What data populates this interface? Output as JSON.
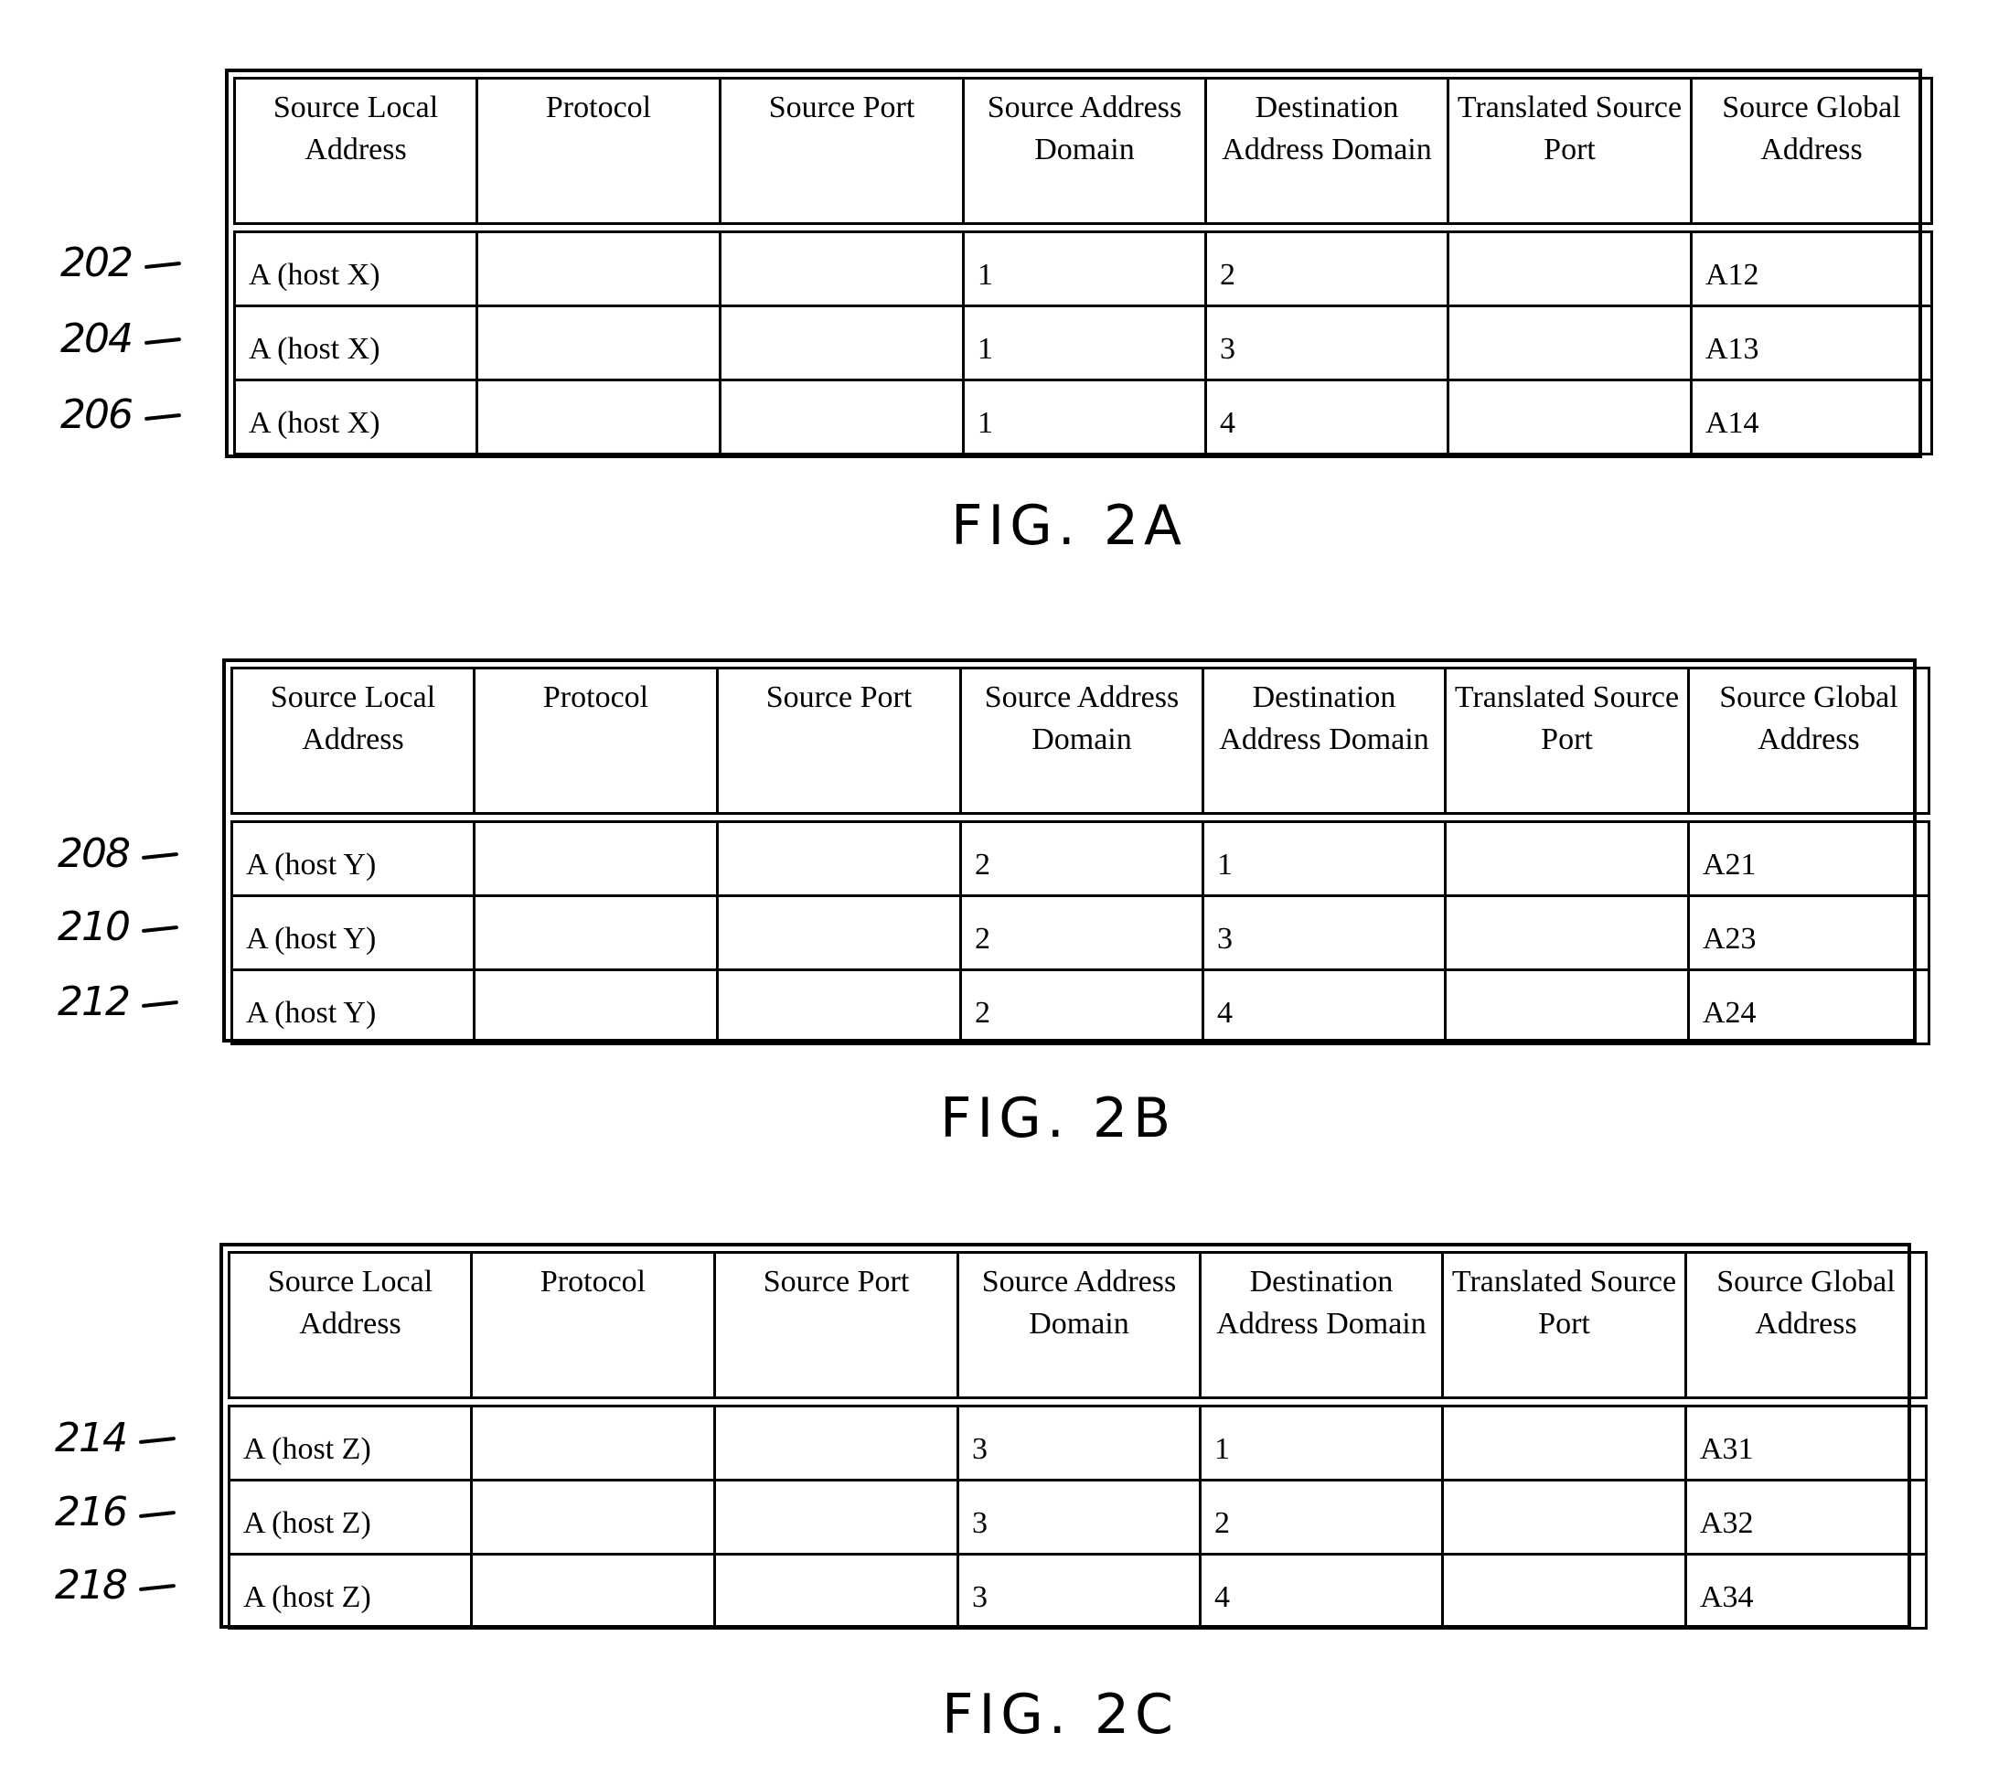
{
  "columns": [
    "Source Local Address",
    "Protocol",
    "Source Port",
    "Source Address Domain",
    "Destination Address Domain",
    "Translated Source Port",
    "Source Global Address"
  ],
  "figures": [
    {
      "label": "FIG. 2A",
      "rows": [
        {
          "ref": "202",
          "cells": [
            "A (host X)",
            "",
            "",
            "1",
            "2",
            "",
            "A12"
          ]
        },
        {
          "ref": "204",
          "cells": [
            "A (host X)",
            "",
            "",
            "1",
            "3",
            "",
            "A13"
          ]
        },
        {
          "ref": "206",
          "cells": [
            "A (host X)",
            "",
            "",
            "1",
            "4",
            "",
            "A14"
          ]
        }
      ]
    },
    {
      "label": "FIG. 2B",
      "rows": [
        {
          "ref": "208",
          "cells": [
            "A (host Y)",
            "",
            "",
            "2",
            "1",
            "",
            "A21"
          ]
        },
        {
          "ref": "210",
          "cells": [
            "A (host Y)",
            "",
            "",
            "2",
            "3",
            "",
            "A23"
          ]
        },
        {
          "ref": "212",
          "cells": [
            "A (host Y)",
            "",
            "",
            "2",
            "4",
            "",
            "A24"
          ]
        }
      ]
    },
    {
      "label": "FIG. 2C",
      "rows": [
        {
          "ref": "214",
          "cells": [
            "A (host Z)",
            "",
            "",
            "3",
            "1",
            "",
            "A31"
          ]
        },
        {
          "ref": "216",
          "cells": [
            "A (host Z)",
            "",
            "",
            "3",
            "2",
            "",
            "A32"
          ]
        },
        {
          "ref": "218",
          "cells": [
            "A (host Z)",
            "",
            "",
            "3",
            "4",
            "",
            "A34"
          ]
        }
      ]
    }
  ]
}
